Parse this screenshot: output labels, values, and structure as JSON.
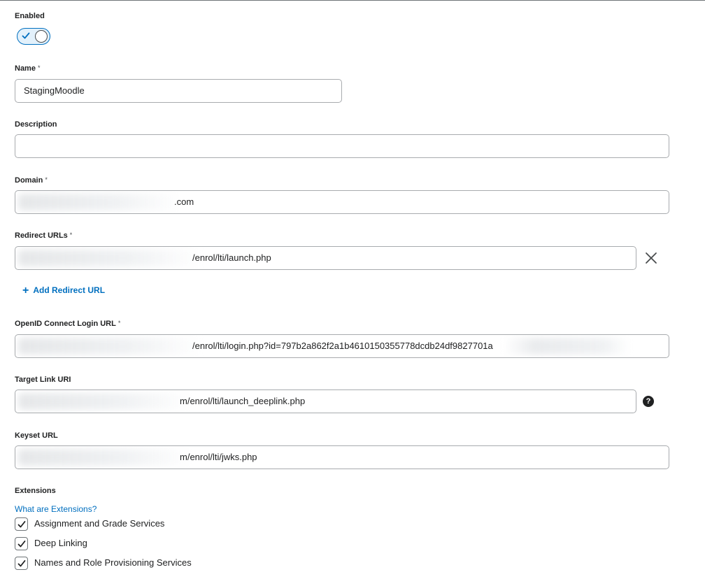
{
  "enabled": {
    "label": "Enabled",
    "value": true
  },
  "name": {
    "label": "Name",
    "required_mark": "*",
    "value": "StagingMoodle"
  },
  "description": {
    "label": "Description",
    "value": ""
  },
  "domain": {
    "label": "Domain",
    "required_mark": "*",
    "visible_value": ".com"
  },
  "redirect_urls": {
    "label": "Redirect URLs",
    "required_mark": "*",
    "items": [
      {
        "visible_value": "/enrol/lti/launch.php"
      }
    ],
    "add_label": "Add Redirect URL"
  },
  "openid_login_url": {
    "label": "OpenID Connect Login URL",
    "required_mark": "*",
    "visible_value": "/enrol/lti/login.php?id=797b2a862f2a1b4610150355778dcdb24df9827701a"
  },
  "target_link_uri": {
    "label": "Target Link URI",
    "visible_value": "m/enrol/lti/launch_deeplink.php",
    "help_glyph": "?"
  },
  "keyset_url": {
    "label": "Keyset URL",
    "visible_value": "m/enrol/lti/jwks.php"
  },
  "extensions": {
    "label": "Extensions",
    "help_link": "What are Extensions?",
    "options": [
      {
        "label": "Assignment and Grade Services",
        "checked": true
      },
      {
        "label": "Deep Linking",
        "checked": true
      },
      {
        "label": "Names and Role Provisioning Services",
        "checked": true
      }
    ]
  },
  "colors": {
    "accent": "#006fbf",
    "border": "#a8abae",
    "text": "#202122"
  }
}
